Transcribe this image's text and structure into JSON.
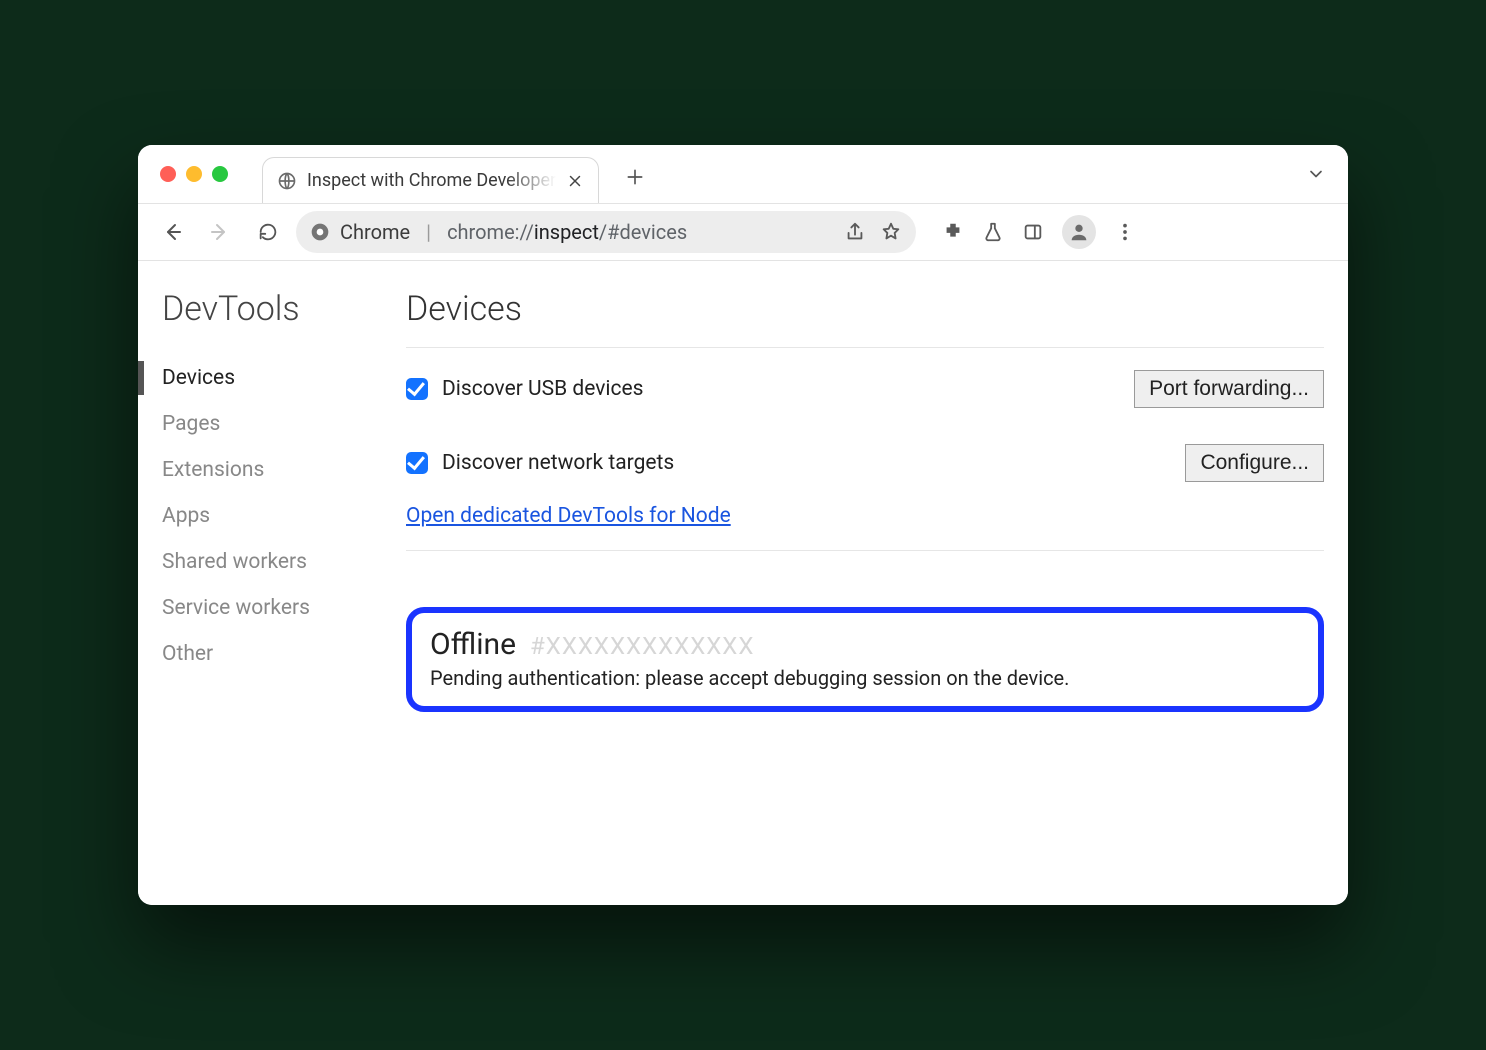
{
  "window": {
    "tab_title": "Inspect with Chrome Developer",
    "url_label": "Chrome",
    "url_prefix": "chrome://",
    "url_main": "inspect",
    "url_suffix": "/#devices"
  },
  "sidebar": {
    "brand": "DevTools",
    "items": [
      {
        "label": "Devices",
        "active": true
      },
      {
        "label": "Pages"
      },
      {
        "label": "Extensions"
      },
      {
        "label": "Apps"
      },
      {
        "label": "Shared workers"
      },
      {
        "label": "Service workers"
      },
      {
        "label": "Other"
      }
    ]
  },
  "main": {
    "title": "Devices",
    "discover_usb_label": "Discover USB devices",
    "discover_usb_checked": true,
    "port_forwarding_label": "Port forwarding...",
    "discover_network_label": "Discover network targets",
    "discover_network_checked": true,
    "configure_label": "Configure...",
    "node_link": "Open dedicated DevTools for Node",
    "device": {
      "status": "Offline",
      "hash": "#XXXXXXXXXXXXX",
      "message": "Pending authentication: please accept debugging session on the device."
    }
  }
}
